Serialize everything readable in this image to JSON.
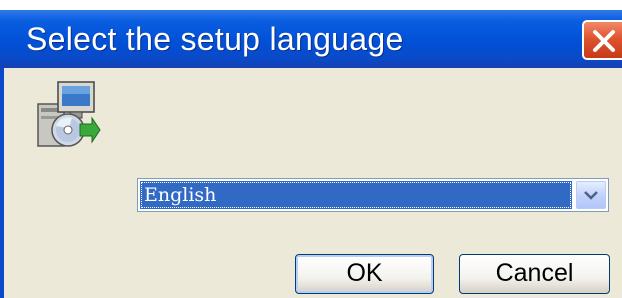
{
  "dialog": {
    "title": "Select the setup language",
    "close_icon": "close-icon",
    "app_icon": "setup-installer-icon"
  },
  "language_select": {
    "selected": "English",
    "arrow_icon": "chevron-down-icon"
  },
  "buttons": {
    "ok_label": "OK",
    "cancel_label": "Cancel"
  },
  "colors": {
    "titlebar": "#0150d6",
    "selection": "#316ac5",
    "window": "#ece9d8",
    "close": "#e0532f"
  }
}
